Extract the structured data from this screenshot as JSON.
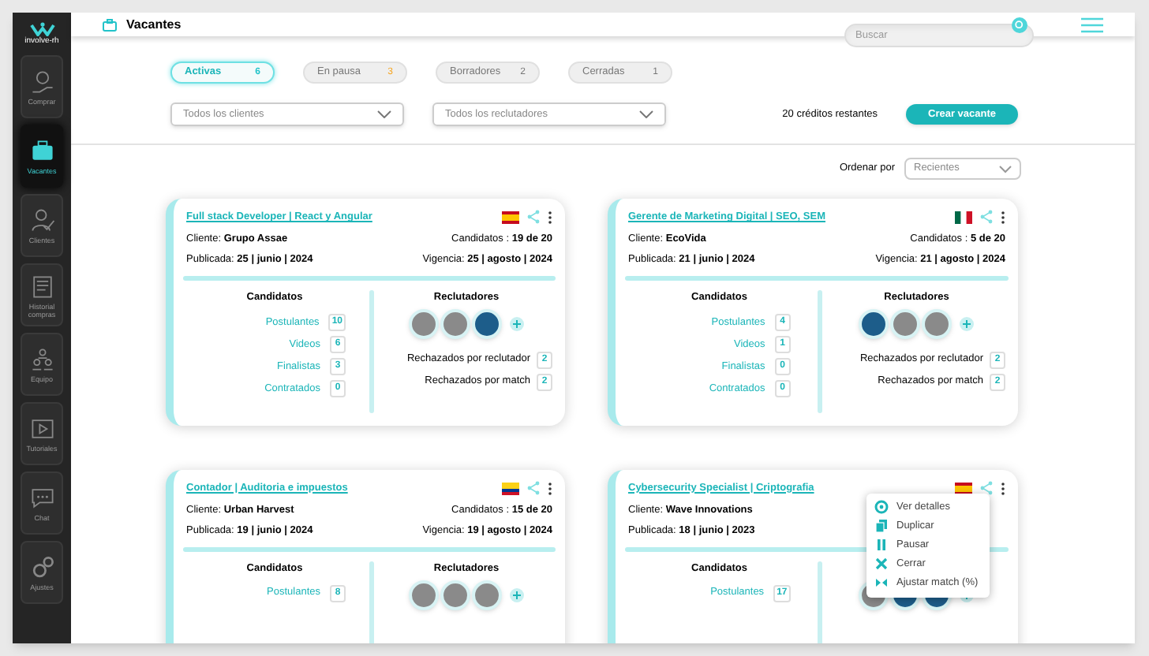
{
  "sidebar": {
    "logo": "involve-rh",
    "items": [
      {
        "label": "Comprar",
        "selected": false
      },
      {
        "label": "Vacantes",
        "selected": true
      },
      {
        "label": "Clientes",
        "selected": false
      },
      {
        "label": "Historial compras",
        "selected": false
      },
      {
        "label": "Equipo",
        "selected": false
      },
      {
        "label": "Tutoriales",
        "selected": false
      },
      {
        "label": "Chat",
        "selected": false
      },
      {
        "label": "Ajustes",
        "selected": false
      }
    ]
  },
  "header": {
    "title": "Vacantes",
    "search": {
      "placeholder": "Buscar"
    }
  },
  "tabs": [
    {
      "label": "Activas",
      "count": "6",
      "selected": true,
      "color": "#22c3c9"
    },
    {
      "label": "En pausa",
      "count": "3",
      "selected": false,
      "color": "#f5a623"
    },
    {
      "label": "Borradores",
      "count": "2",
      "selected": false,
      "color": "#777777"
    },
    {
      "label": "Cerradas",
      "count": "1",
      "selected": false,
      "color": "#777777"
    }
  ],
  "filters": [
    {
      "value": "Todos los clientes"
    },
    {
      "value": "Todos los reclutadores"
    }
  ],
  "credits": "20 créditos restantes",
  "create_button": "Crear vacante",
  "sort": {
    "label": "Ordenar por",
    "value": "Recientes"
  },
  "cards": [
    {
      "title": "Full stack Developer | React y Angular",
      "client_label": "Cliente:",
      "client": "Grupo Assae",
      "candidates_label": "Candidatos :",
      "candidates": "19 de 20",
      "published_label": "Publicada:",
      "published": "25 | junio | 2024",
      "validity_label": "Vigencia:",
      "validity": "25 | agosto | 2024",
      "stats_title": "Candidatos",
      "stats": [
        {
          "label": "Postulantes",
          "count": "10"
        },
        {
          "label": "Videos",
          "count": "6"
        },
        {
          "label": "Finalistas",
          "count": "3"
        },
        {
          "label": "Contratados",
          "count": "0"
        }
      ],
      "recruiters_title": "Reclutadores",
      "recruiters": [
        {
          "kind": "photo"
        },
        {
          "kind": "photo"
        },
        {
          "kind": "logo"
        }
      ],
      "rejected": [
        {
          "label": "Rechazados por reclutador",
          "count": "2"
        },
        {
          "label": "Rechazados por match",
          "count": "2"
        }
      ]
    },
    {
      "title": "Gerente de Marketing Digital | SEO, SEM",
      "client_label": "Cliente:",
      "client": "EcoVida",
      "candidates_label": "Candidatos :",
      "candidates": "5 de 20",
      "published_label": "Publicada:",
      "published": "21 | junio | 2024",
      "validity_label": "Vigencia:",
      "validity": "21 | agosto | 2024",
      "stats_title": "Candidatos",
      "stats": [
        {
          "label": "Postulantes",
          "count": "4"
        },
        {
          "label": "Videos",
          "count": "1"
        },
        {
          "label": "Finalistas",
          "count": "0"
        },
        {
          "label": "Contratados",
          "count": "0"
        }
      ],
      "recruiters_title": "Reclutadores",
      "recruiters": [
        {
          "kind": "logo"
        },
        {
          "kind": "photo"
        },
        {
          "kind": "photo"
        }
      ],
      "rejected": [
        {
          "label": "Rechazados por reclutador",
          "count": "2"
        },
        {
          "label": "Rechazados por match",
          "count": "2"
        }
      ]
    },
    {
      "title": "Contador | Auditoria e impuestos",
      "client_label": "Cliente:",
      "client": "Urban Harvest",
      "candidates_label": "Candidatos :",
      "candidates": "15 de 20",
      "published_label": "Publicada:",
      "published": "19 | junio | 2024",
      "validity_label": "Vigencia:",
      "validity": "19 | agosto | 2024",
      "stats_title": "Candidatos",
      "stats": [
        {
          "label": "Postulantes",
          "count": "8"
        }
      ],
      "recruiters_title": "Reclutadores",
      "recruiters": [
        {
          "kind": "photo"
        },
        {
          "kind": "photo"
        },
        {
          "kind": "photo"
        }
      ]
    },
    {
      "title": "Cybersecurity Specialist | Criptografia",
      "client_label": "Cliente:",
      "client": "Wave Innovations",
      "published_label": "Publicada:",
      "published": "18 | junio | 2023",
      "stats_title": "Candidatos",
      "stats": [
        {
          "label": "Postulantes",
          "count": "17"
        }
      ],
      "recruiters": [
        {
          "kind": "photo"
        },
        {
          "kind": "logo"
        },
        {
          "kind": "logo"
        }
      ],
      "menu": [
        {
          "label": "Ver detalles"
        },
        {
          "label": "Duplicar"
        },
        {
          "label": "Pausar"
        },
        {
          "label": "Cerrar"
        },
        {
          "label": "Ajustar match (%)"
        }
      ]
    }
  ]
}
